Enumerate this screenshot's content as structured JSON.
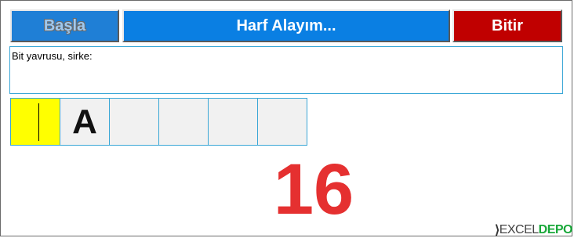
{
  "toolbar": {
    "start_label": "Başla",
    "prompt_label": "Harf Alayım...",
    "end_label": "Bitir"
  },
  "clue": {
    "text": "Bit yavrusu, sirke:"
  },
  "answer_cells": [
    {
      "letter": "",
      "active": true
    },
    {
      "letter": "A",
      "active": false
    },
    {
      "letter": "",
      "active": false
    },
    {
      "letter": "",
      "active": false
    },
    {
      "letter": "",
      "active": false
    },
    {
      "letter": "",
      "active": false
    }
  ],
  "score": {
    "value": "16"
  },
  "watermark": {
    "text_dark": "EXCEL",
    "text_green": "DEPO"
  },
  "colors": {
    "start_button": "#1f7fd6",
    "prompt_button": "#0a7fe3",
    "end_button": "#c00000",
    "active_cell": "#ffff00",
    "score_text": "#e53030"
  }
}
